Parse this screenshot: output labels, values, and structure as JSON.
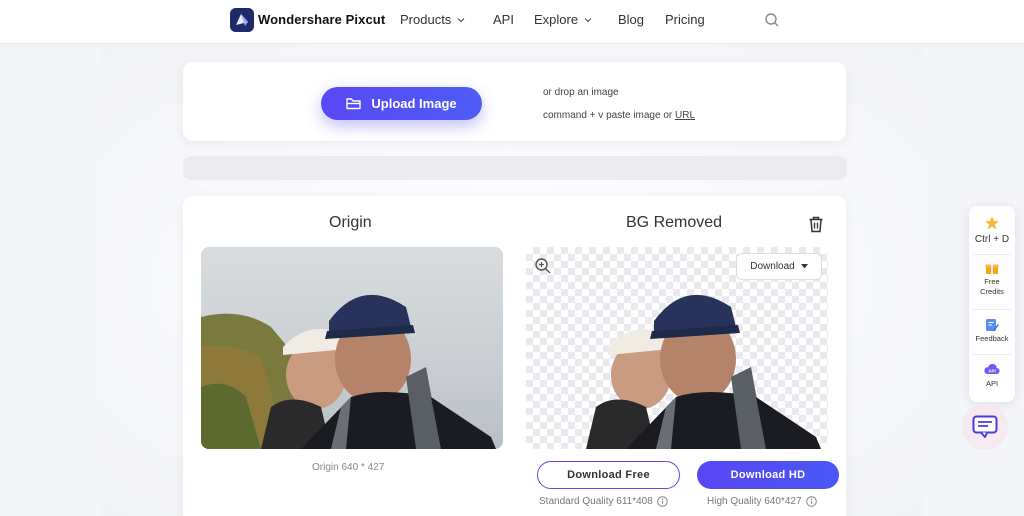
{
  "nav": {
    "brand": "Wondershare Pixcut",
    "items": [
      {
        "label": "Products",
        "dropdown": true
      },
      {
        "label": "API",
        "dropdown": false
      },
      {
        "label": "Explore",
        "dropdown": true
      },
      {
        "label": "Blog",
        "dropdown": false
      },
      {
        "label": "Pricing",
        "dropdown": false
      }
    ]
  },
  "upload": {
    "button_label": "Upload Image",
    "hint_drop": "or drop an image",
    "hint_paste": "command + v paste image or ",
    "hint_url": "URL"
  },
  "result": {
    "origin_title": "Origin",
    "removed_title": "BG Removed",
    "download_dropdown": "Download",
    "origin_caption": "Origin 640 * 427",
    "download_free": "Download Free",
    "download_hd": "Download HD",
    "standard_quality": "Standard Quality 611*408",
    "high_quality": "High Quality 640*427"
  },
  "side_toolbar": {
    "shortcut": "Ctrl + D",
    "free_credits": "Free Credits",
    "feedback": "Feedback",
    "api": "API"
  },
  "colors": {
    "accent": "#5a48f5",
    "background": "#f4f5f8",
    "panel": "#ffffff"
  }
}
